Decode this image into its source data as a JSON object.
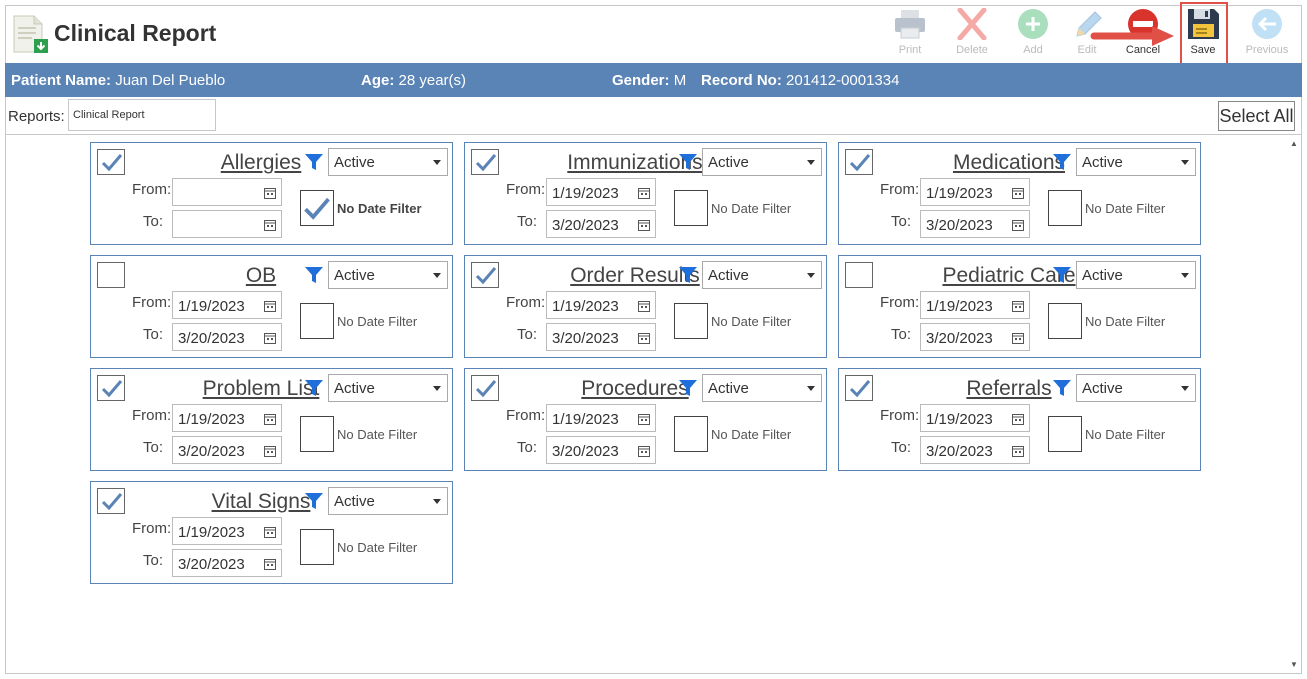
{
  "app": {
    "title": "Clinical Report"
  },
  "toolbar": [
    {
      "key": "print",
      "label": "Print",
      "enabled": false
    },
    {
      "key": "delete",
      "label": "Delete",
      "enabled": false
    },
    {
      "key": "add",
      "label": "Add",
      "enabled": false
    },
    {
      "key": "edit",
      "label": "Edit",
      "enabled": false
    },
    {
      "key": "cancel",
      "label": "Cancel",
      "enabled": true
    },
    {
      "key": "save",
      "label": "Save",
      "enabled": true,
      "highlighted": true
    },
    {
      "key": "previous",
      "label": "Previous",
      "enabled": false
    }
  ],
  "patient": {
    "name_label": "Patient Name:",
    "name": "Juan Del Pueblo",
    "age_label": "Age:",
    "age": "28 year(s)",
    "gender_label": "Gender:",
    "gender": "M",
    "record_label": "Record No:",
    "record": "201412-0001334"
  },
  "reports": {
    "label": "Reports:",
    "value": "Clinical Report",
    "select_all": "Select All"
  },
  "labels": {
    "from": "From:",
    "to": "To:",
    "no_date_filter": "No Date Filter"
  },
  "sections": [
    {
      "title": "Allergies",
      "checked": true,
      "status": "Active",
      "from": "",
      "to": "",
      "no_date_filter": true
    },
    {
      "title": "Immunizations",
      "checked": true,
      "status": "Active",
      "from": "1/19/2023",
      "to": "3/20/2023",
      "no_date_filter": false
    },
    {
      "title": "Medications",
      "checked": true,
      "status": "Active",
      "from": "1/19/2023",
      "to": "3/20/2023",
      "no_date_filter": false
    },
    {
      "title": "OB",
      "checked": false,
      "status": "Active",
      "from": "1/19/2023",
      "to": "3/20/2023",
      "no_date_filter": false
    },
    {
      "title": "Order Results",
      "checked": true,
      "status": "Active",
      "from": "1/19/2023",
      "to": "3/20/2023",
      "no_date_filter": false
    },
    {
      "title": "Pediatric Care",
      "checked": false,
      "status": "Active",
      "from": "1/19/2023",
      "to": "3/20/2023",
      "no_date_filter": false
    },
    {
      "title": "Problem List",
      "checked": true,
      "status": "Active",
      "from": "1/19/2023",
      "to": "3/20/2023",
      "no_date_filter": false
    },
    {
      "title": "Procedures",
      "checked": true,
      "status": "Active",
      "from": "1/19/2023",
      "to": "3/20/2023",
      "no_date_filter": false
    },
    {
      "title": "Referrals",
      "checked": true,
      "status": "Active",
      "from": "1/19/2023",
      "to": "3/20/2023",
      "no_date_filter": false
    },
    {
      "title": "Vital Signs",
      "checked": true,
      "status": "Active",
      "from": "1/19/2023",
      "to": "3/20/2023",
      "no_date_filter": false
    }
  ],
  "colors": {
    "accent": "#5a83b6",
    "highlight": "#e05046",
    "filter": "#1e6fd9",
    "check": "#5a83b6"
  }
}
